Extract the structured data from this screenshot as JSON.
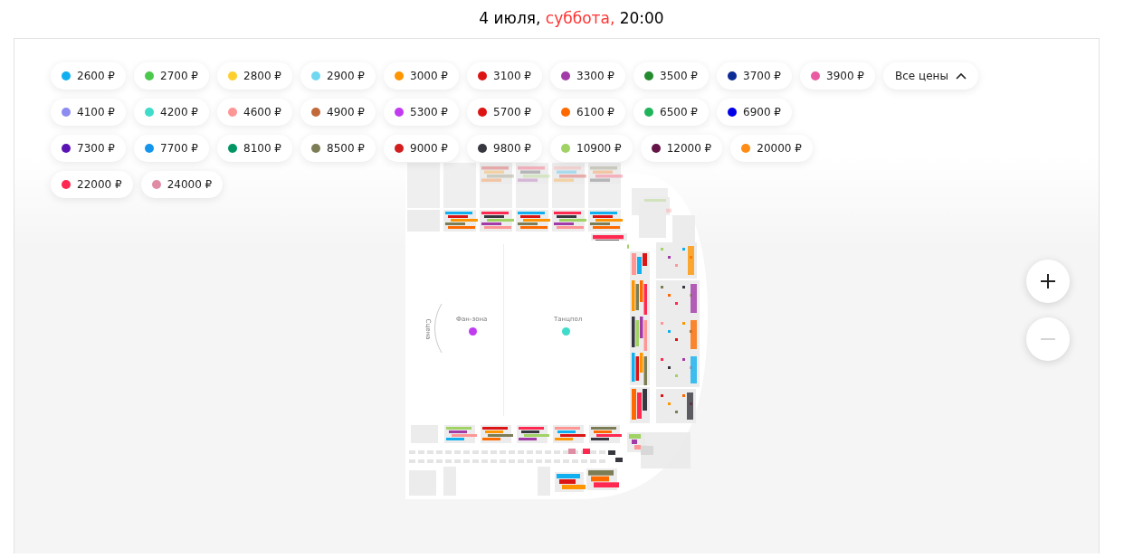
{
  "header": {
    "date": "4 июля,",
    "weekday": "суббота,",
    "weekend": true,
    "time": "20:00"
  },
  "price_filter": {
    "rows": [
      {
        "items": [
          {
            "label": "2600 ₽",
            "color": "#10b0f0"
          },
          {
            "label": "2700 ₽",
            "color": "#4cc94c"
          },
          {
            "label": "2800 ₽",
            "color": "#ffcf2e"
          },
          {
            "label": "2900 ₽",
            "color": "#6fd8f0"
          },
          {
            "label": "3000 ₽",
            "color": "#ff9500"
          },
          {
            "label": "3100 ₽",
            "color": "#dc1414"
          },
          {
            "label": "3300 ₽",
            "color": "#a23aa8"
          },
          {
            "label": "3500 ₽",
            "color": "#238b2e"
          },
          {
            "label": "3700 ₽",
            "color": "#0b2c95"
          },
          {
            "label": "3900 ₽",
            "color": "#e85ba3"
          }
        ]
      },
      {
        "items": [
          {
            "label": "4100 ₽",
            "color": "#8c8cf0"
          },
          {
            "label": "4200 ₽",
            "color": "#3fdccb"
          },
          {
            "label": "4600 ₽",
            "color": "#ff9696"
          },
          {
            "label": "4900 ₽",
            "color": "#c2693a"
          },
          {
            "label": "5300 ₽",
            "color": "#c13cf0"
          },
          {
            "label": "5700 ₽",
            "color": "#dc1414"
          },
          {
            "label": "6100 ₽",
            "color": "#ff6a00"
          },
          {
            "label": "6500 ₽",
            "color": "#20b45a"
          },
          {
            "label": "6900 ₽",
            "color": "#0000e6"
          }
        ]
      },
      {
        "items": [
          {
            "label": "7300 ₽",
            "color": "#5a14b4"
          },
          {
            "label": "7700 ₽",
            "color": "#1496ec"
          },
          {
            "label": "8100 ₽",
            "color": "#009664"
          },
          {
            "label": "8500 ₽",
            "color": "#7d7d55"
          },
          {
            "label": "9000 ₽",
            "color": "#d21e1e"
          },
          {
            "label": "9800 ₽",
            "color": "#37373f"
          },
          {
            "label": "10900 ₽",
            "color": "#a0d264"
          },
          {
            "label": "12000 ₽",
            "color": "#641446"
          },
          {
            "label": "20000 ₽",
            "color": "#ff8c14"
          }
        ]
      },
      {
        "items": [
          {
            "label": "22000 ₽",
            "color": "#ff2850"
          },
          {
            "label": "24000 ₽",
            "color": "#e08ca5"
          }
        ]
      }
    ],
    "toggle": {
      "label": "Все цены",
      "expanded": true
    }
  },
  "map": {
    "zones": [
      {
        "label": "Фан-зона",
        "color": "#c13cf0"
      },
      {
        "label": "Танцпол",
        "color": "#3fdccb"
      }
    ],
    "stage": {
      "label": "Сцена"
    }
  },
  "zoom": {
    "zoom_in": {
      "disabled": false
    },
    "zoom_out": {
      "disabled": true
    }
  }
}
